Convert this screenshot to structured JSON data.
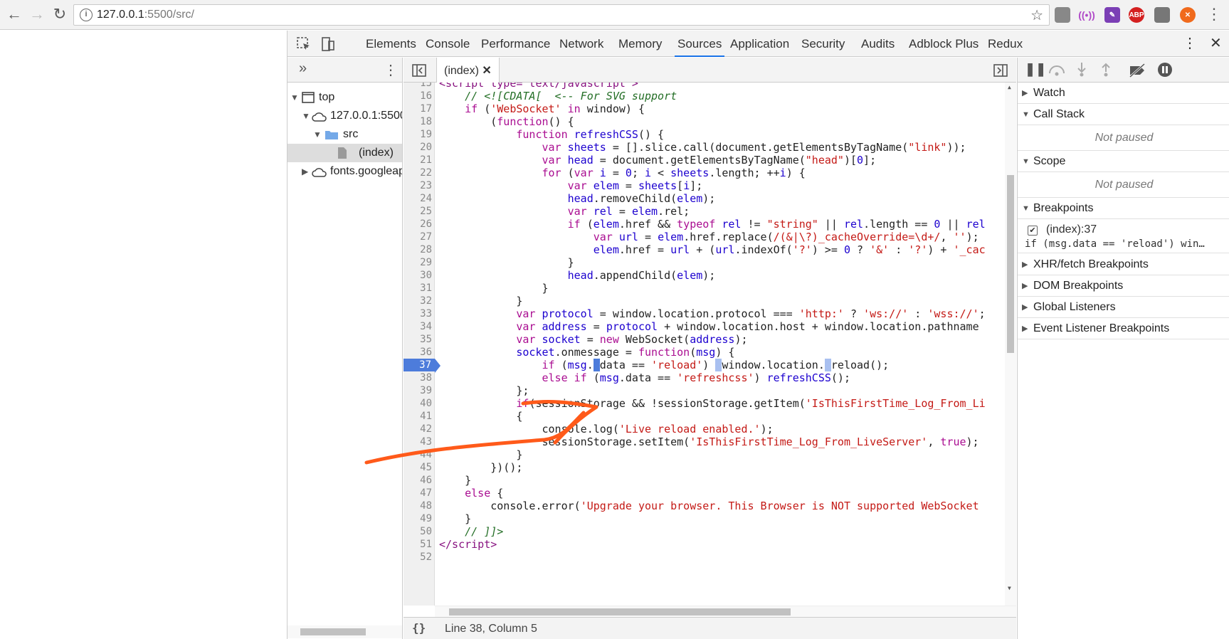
{
  "browser": {
    "url_host": "127.0.0.1",
    "url_rest": ":5500/src/",
    "back_icon": "back-arrow-icon",
    "forward_icon": "forward-arrow-icon",
    "reload_icon": "reload-icon",
    "star_icon": "star-icon",
    "extensions": [
      "globe-icon",
      "wifi-icon",
      "pen-icon",
      "abp-icon",
      "tab-icon",
      "orange-icon"
    ],
    "abp_label": "ABP"
  },
  "devtools": {
    "tabs": [
      "Elements",
      "Console",
      "Performance",
      "Network",
      "Memory",
      "Sources",
      "Application",
      "Security",
      "Audits",
      "Adblock Plus",
      "Redux"
    ],
    "active_tab": "Sources",
    "nav_tree": {
      "top": "top",
      "host": "127.0.0.1:5500",
      "folder": "src",
      "file": "(index)",
      "fonts": "fonts.googleapis.com"
    },
    "editor": {
      "tab_label": "(index)",
      "status": "Line 38, Column 5",
      "braces": "{}"
    },
    "side": {
      "watch": "Watch",
      "call_stack": "Call Stack",
      "not_paused_1": "Not paused",
      "scope": "Scope",
      "not_paused_2": "Not paused",
      "breakpoints": "Breakpoints",
      "bp_location": "(index):37",
      "bp_code": "if (msg.data == 'reload') win…",
      "xhr": "XHR/fetch Breakpoints",
      "dom": "DOM Breakpoints",
      "global": "Global Listeners",
      "event": "Event Listener Breakpoints"
    }
  }
}
